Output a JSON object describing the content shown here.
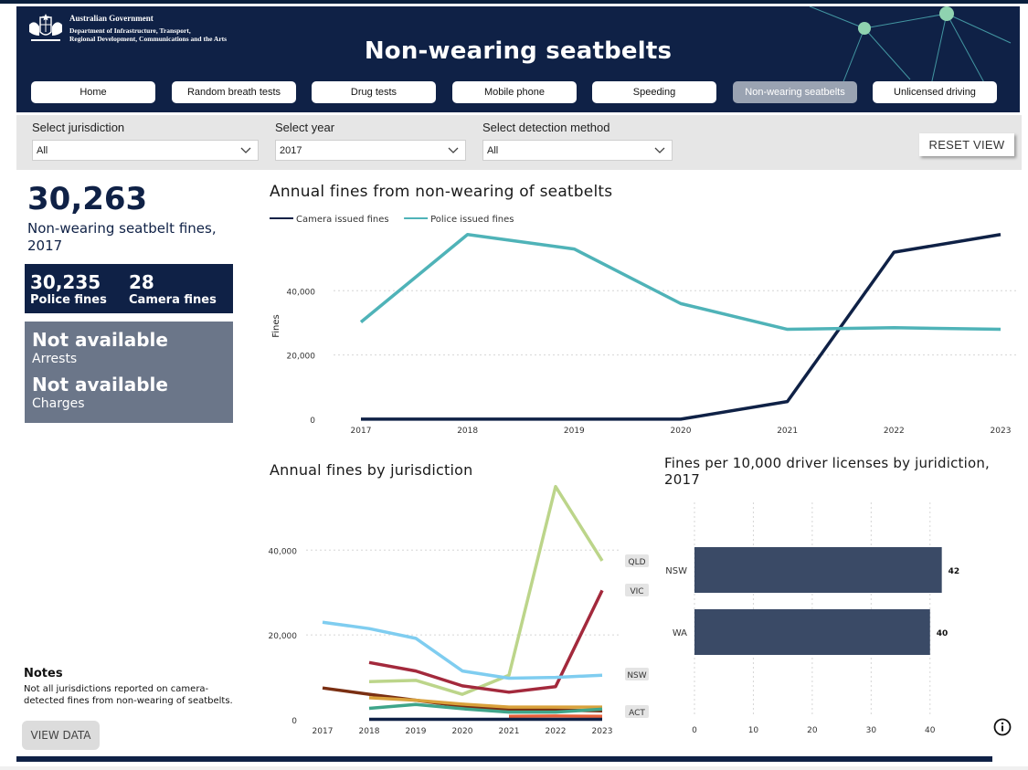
{
  "header": {
    "gov_line1": "Australian Government",
    "gov_line2": "Department of Infrastructure, Transport,",
    "gov_line3": "Regional Development, Communications and the Arts",
    "title": "Non-wearing seatbelts"
  },
  "nav": [
    {
      "label": "Home",
      "active": false
    },
    {
      "label": "Random breath tests",
      "active": false
    },
    {
      "label": "Drug tests",
      "active": false
    },
    {
      "label": "Mobile phone",
      "active": false
    },
    {
      "label": "Speeding",
      "active": false
    },
    {
      "label": "Non-wearing seatbelts",
      "active": true
    },
    {
      "label": "Unlicensed driving",
      "active": false
    }
  ],
  "filters": {
    "jurisdiction": {
      "label": "Select jurisdiction",
      "value": "All"
    },
    "year": {
      "label": "Select year",
      "value": "2017"
    },
    "method": {
      "label": "Select detection method",
      "value": "All"
    },
    "reset_label": "RESET VIEW"
  },
  "kpi": {
    "total": "30,263",
    "total_label": "Non-wearing seatbelt fines, 2017",
    "police_value": "30,235",
    "police_label": "Police fines",
    "camera_value": "28",
    "camera_label": "Camera fines",
    "arrests_value": "Not available",
    "arrests_label": "Arrests",
    "charges_value": "Not available",
    "charges_label": "Charges"
  },
  "notes": {
    "title": "Notes",
    "text": "Not all jurisdictions reported on camera-detected fines from non-wearing of seatbelts."
  },
  "view_data_label": "VIEW DATA",
  "colors": {
    "navy": "#0f2146",
    "teal": "#4fb3b8",
    "slate": "#6b7689",
    "bar": "#3a4a66"
  },
  "chart_data": [
    {
      "type": "line",
      "title": "Annual fines from non-wearing of seatbelts",
      "ylabel": "Fines",
      "x": [
        "2017",
        "2018",
        "2019",
        "2020",
        "2021",
        "2022",
        "2023"
      ],
      "ylim": [
        0,
        58000
      ],
      "yticks": [
        "0",
        "20,000",
        "40,000"
      ],
      "ytick_values": [
        0,
        20000,
        40000
      ],
      "series": [
        {
          "name": "Camera issued fines",
          "color": "#0f2146",
          "values": [
            28,
            40,
            40,
            30,
            5500,
            52000,
            57500
          ]
        },
        {
          "name": "Police issued fines",
          "color": "#4fb3b8",
          "values": [
            30235,
            57500,
            53000,
            36000,
            28000,
            28500,
            28000
          ]
        }
      ],
      "legend": "top-left",
      "grid": true
    },
    {
      "type": "line",
      "title": "Annual fines by jurisdiction",
      "x": [
        "2017",
        "2018",
        "2019",
        "2020",
        "2021",
        "2022",
        "2023"
      ],
      "ylim": [
        0,
        56000
      ],
      "yticks": [
        "0",
        "20,000",
        "40,000"
      ],
      "ytick_values": [
        0,
        20000,
        40000
      ],
      "series": [
        {
          "name": "QLD",
          "color": "#bcd58a",
          "values": [
            null,
            9000,
            9300,
            6000,
            10500,
            55000,
            37500
          ]
        },
        {
          "name": "VIC",
          "color": "#a3293c",
          "values": [
            null,
            13500,
            11500,
            8000,
            6500,
            7800,
            30500
          ]
        },
        {
          "name": "NSW",
          "color": "#7fcdf0",
          "values": [
            23000,
            21500,
            19200,
            11500,
            9800,
            10000,
            10500
          ]
        },
        {
          "name": "",
          "color": "#7a2f12",
          "values": [
            7500,
            6000,
            4600,
            3200,
            2500,
            2300,
            2100
          ]
        },
        {
          "name": "",
          "color": "#d9a23c",
          "values": [
            null,
            5200,
            4600,
            3700,
            3000,
            3000,
            3000
          ]
        },
        {
          "name": "",
          "color": "#3fa58a",
          "values": [
            null,
            2700,
            3600,
            2600,
            1800,
            1800,
            2500
          ]
        },
        {
          "name": "ACT",
          "color": "#e8603a",
          "values": [
            null,
            null,
            null,
            null,
            800,
            900,
            800
          ]
        },
        {
          "name": "",
          "color": "#0f2146",
          "values": [
            null,
            100,
            100,
            100,
            100,
            100,
            100
          ]
        }
      ],
      "labels": [
        "QLD",
        "VIC",
        "NSW",
        "ACT"
      ],
      "grid": true
    },
    {
      "type": "bar",
      "orientation": "horizontal",
      "title": "Fines per 10,000 driver licenses by juridiction, 2017",
      "categories": [
        "NSW",
        "WA"
      ],
      "values": [
        42,
        40
      ],
      "xlim": [
        0,
        45
      ],
      "xticks": [
        "0",
        "10",
        "20",
        "30",
        "40"
      ],
      "xtick_values": [
        0,
        10,
        20,
        30,
        40
      ],
      "color": "#3a4a66",
      "grid": true
    }
  ]
}
